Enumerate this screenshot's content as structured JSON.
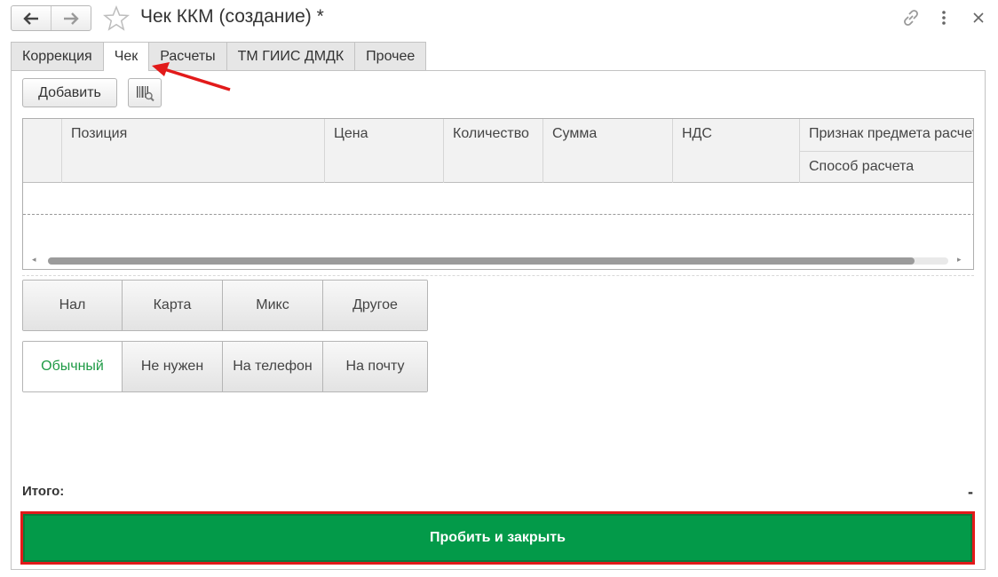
{
  "window": {
    "title": "Чек ККМ (создание) *",
    "back_icon": "arrow-left-icon",
    "forward_icon": "arrow-right-icon",
    "favorite_icon": "star-icon",
    "link_icon": "link-icon",
    "more_icon": "more-vertical-icon",
    "close_icon": "close-icon"
  },
  "tabs": [
    {
      "label": "Коррекция",
      "active": false
    },
    {
      "label": "Чек",
      "active": true
    },
    {
      "label": "Расчеты",
      "active": false
    },
    {
      "label": "ТМ ГИИС ДМДК",
      "active": false
    },
    {
      "label": "Прочее",
      "active": false
    }
  ],
  "toolbar": {
    "add_label": "Добавить",
    "barcode_icon": "barcode-search-icon"
  },
  "table": {
    "columns": [
      "Позиция",
      "Цена",
      "Количество",
      "Сумма",
      "НДС",
      "Признак предмета расчета",
      "Способ расчета"
    ],
    "rows": []
  },
  "payment_types": [
    {
      "label": "Нал",
      "selected": false
    },
    {
      "label": "Карта",
      "selected": false
    },
    {
      "label": "Микс",
      "selected": false
    },
    {
      "label": "Другое",
      "selected": false
    }
  ],
  "receipt_delivery": [
    {
      "label": "Обычный",
      "selected": true
    },
    {
      "label": "Не нужен",
      "selected": false
    },
    {
      "label": "На телефон",
      "selected": false
    },
    {
      "label": "На почту",
      "selected": false
    }
  ],
  "totals": {
    "label": "Итого:",
    "value": "-"
  },
  "submit": {
    "label": "Пробить и закрыть"
  },
  "colors": {
    "accent_green": "#039a49",
    "selected_text_green": "#1e9a45",
    "annotation_red": "#e21a1a"
  }
}
